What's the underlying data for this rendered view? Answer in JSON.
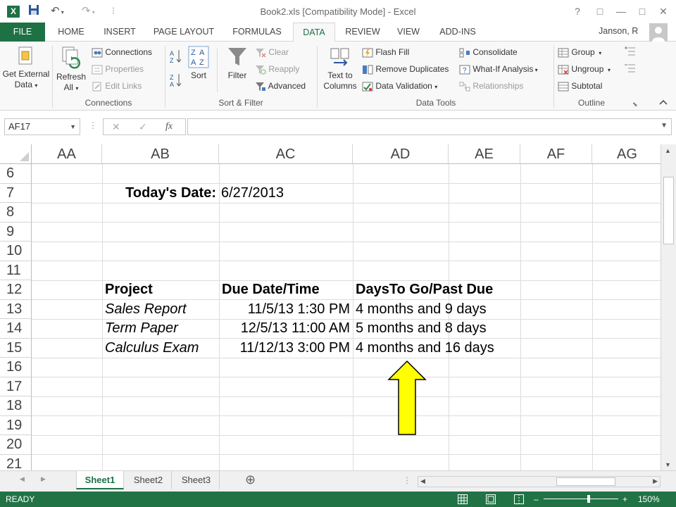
{
  "window": {
    "title": "Book2.xls  [Compatibility Mode] - Excel",
    "help": "?",
    "ribbon_display": "□",
    "minimize": "—",
    "maximize": "□",
    "close": "✕"
  },
  "qat": {
    "save": "💾",
    "undo": "↶",
    "redo": "↷"
  },
  "tabs": [
    {
      "label": "FILE"
    },
    {
      "label": "HOME"
    },
    {
      "label": "INSERT"
    },
    {
      "label": "PAGE LAYOUT"
    },
    {
      "label": "FORMULAS"
    },
    {
      "label": "DATA"
    },
    {
      "label": "REVIEW"
    },
    {
      "label": "VIEW"
    },
    {
      "label": "ADD-INS"
    }
  ],
  "user": "Janson, R",
  "ribbon": {
    "get_external_data": {
      "line1": "Get External",
      "line2": "Data"
    },
    "connections": {
      "refresh_line1": "Refresh",
      "refresh_line2": "All",
      "connections": "Connections",
      "properties": "Properties",
      "edit_links": "Edit Links",
      "group_label": "Connections"
    },
    "sort_filter": {
      "sort": "Sort",
      "filter": "Filter",
      "clear": "Clear",
      "reapply": "Reapply",
      "advanced": "Advanced",
      "group_label": "Sort & Filter"
    },
    "data_tools": {
      "text_to_columns_line1": "Text to",
      "text_to_columns_line2": "Columns",
      "flash_fill": "Flash Fill",
      "remove_duplicates": "Remove Duplicates",
      "data_validation": "Data Validation",
      "consolidate": "Consolidate",
      "what_if": "What-If Analysis",
      "relationships": "Relationships",
      "group_label": "Data Tools"
    },
    "outline": {
      "group": "Group",
      "ungroup": "Ungroup",
      "subtotal": "Subtotal",
      "group_label": "Outline"
    }
  },
  "formula_bar": {
    "name_box": "AF17",
    "fx": "fx",
    "cancel": "✕",
    "enter": "✓",
    "content": ""
  },
  "columns": [
    "AA",
    "AB",
    "AC",
    "AD",
    "AE",
    "AF",
    "AG"
  ],
  "rows": [
    "6",
    "7",
    "8",
    "9",
    "10",
    "11",
    "12",
    "13",
    "14",
    "15",
    "16",
    "17",
    "18",
    "19",
    "20",
    "21"
  ],
  "cells": {
    "todays_date_label": "Today's Date:",
    "todays_date_value": "6/27/2013",
    "header_project": "Project",
    "header_due": "Due Date/Time",
    "header_days": "DaysTo Go/Past Due",
    "projects": [
      {
        "name": "Sales Report",
        "due": "11/5/13 1:30 PM",
        "days": "4 months and 9 days"
      },
      {
        "name": "Term Paper",
        "due": "12/5/13 11:00 AM",
        "days": "5 months and 8 days"
      },
      {
        "name": "Calculus Exam",
        "due": "11/12/13 3:00 PM",
        "days": "4 months and 16 days"
      }
    ]
  },
  "arrow_color": "#ffff00",
  "sheets": [
    {
      "label": "Sheet1"
    },
    {
      "label": "Sheet2"
    },
    {
      "label": "Sheet3"
    }
  ],
  "add_sheet": "⊕",
  "status": {
    "ready": "READY",
    "zoom": "150%"
  },
  "accent": "#217346"
}
